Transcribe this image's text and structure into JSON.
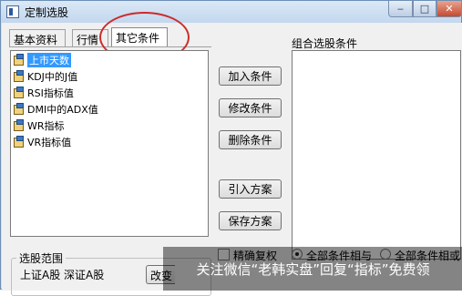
{
  "window": {
    "title": "定制选股"
  },
  "tabs": [
    {
      "label": "基本资料"
    },
    {
      "label": "行情"
    },
    {
      "label": "其它条件",
      "active": true
    }
  ],
  "conditions": [
    {
      "label": "上市天数",
      "selected": true
    },
    {
      "label": "KDJ中的J值"
    },
    {
      "label": "RSI指标值"
    },
    {
      "label": "DMI中的ADX值"
    },
    {
      "label": "WR指标"
    },
    {
      "label": "VR指标值"
    }
  ],
  "buttons": {
    "add": "加入条件",
    "modify": "修改条件",
    "delete": "删除条件",
    "import": "引入方案",
    "save": "保存方案"
  },
  "combo": {
    "label": "组合选股条件"
  },
  "options": {
    "precise_restore": "精确复权",
    "all_and": "全部条件相与",
    "all_or": "全部条件相或"
  },
  "scope": {
    "title": "选股范围",
    "markets": "上证A股 深证A股",
    "change_button": "改变"
  },
  "watermark": "关注微信“老韩实盘”回复“指标”免费领",
  "colors": {
    "selection": "#3399ff",
    "highlight_circle": "#cc2b2b"
  }
}
